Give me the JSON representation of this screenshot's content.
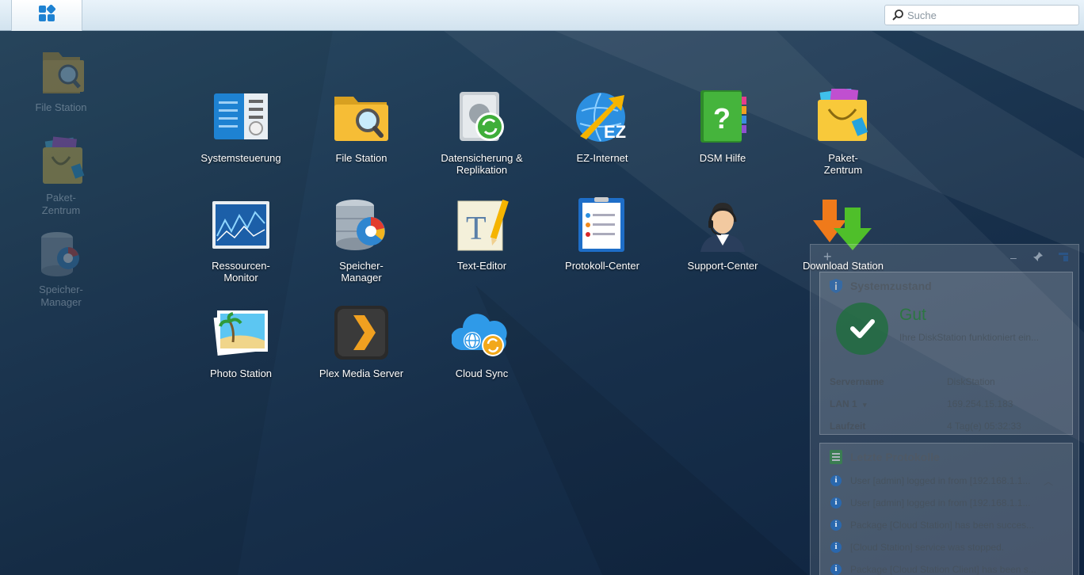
{
  "taskbar": {
    "main_menu_icon": "main-menu-grid-icon",
    "search": {
      "placeholder": "Suche",
      "value": "",
      "icon": "search-icon"
    }
  },
  "desktop_shortcuts": [
    {
      "label": "File Station",
      "icon": "file-station-icon"
    },
    {
      "label": "Paket-\nZentrum",
      "icon": "package-center-icon"
    },
    {
      "label": "Speicher-\nManager",
      "icon": "storage-manager-icon"
    }
  ],
  "main_menu": {
    "apps": [
      {
        "label": "Systemsteuerung",
        "icon": "control-panel-icon"
      },
      {
        "label": "File Station",
        "icon": "file-station-icon"
      },
      {
        "label": "Datensicherung &\nReplikation",
        "icon": "backup-replication-icon"
      },
      {
        "label": "EZ-Internet",
        "icon": "ez-internet-icon"
      },
      {
        "label": "DSM Hilfe",
        "icon": "help-icon"
      },
      {
        "label": "Paket-\nZentrum",
        "icon": "package-center-icon"
      },
      {
        "label": "Ressourcen-\nMonitor",
        "icon": "resource-monitor-icon"
      },
      {
        "label": "Speicher-\nManager",
        "icon": "storage-manager-icon"
      },
      {
        "label": "Text-Editor",
        "icon": "text-editor-icon"
      },
      {
        "label": "Protokoll-Center",
        "icon": "log-center-icon"
      },
      {
        "label": "Support-Center",
        "icon": "support-center-icon"
      },
      {
        "label": "Download Station",
        "icon": "download-station-icon"
      },
      {
        "label": "Photo Station",
        "icon": "photo-station-icon"
      },
      {
        "label": "Plex Media Server",
        "icon": "plex-icon"
      },
      {
        "label": "Cloud Sync",
        "icon": "cloud-sync-icon"
      }
    ]
  },
  "widgets": {
    "toolbar": {
      "add": "+",
      "minimize": "–"
    },
    "system_health": {
      "title": "Systemzustand",
      "status": "Gut",
      "status_text": "Ihre DiskStation funktioniert ein...",
      "rows": [
        {
          "key": "Servername",
          "value": "DiskStation"
        },
        {
          "key": "LAN 1",
          "value": "169.254.15.183"
        },
        {
          "key": "Laufzeit",
          "value": "4 Tag(e) 05:32:33"
        }
      ]
    },
    "recent_logs": {
      "title": "Letzte Protokolle",
      "items": [
        "User [admin] logged in from [192.168.1.1...",
        "User [admin] logged in from [192.168.1.1...",
        "Package [Cloud Station] has been succes...",
        "[Cloud Station] service was stopped.",
        "Package [Cloud Station Client] has been s..."
      ]
    }
  },
  "colors": {
    "taskbar": "#d2e3ef",
    "accent": "#1e82d2",
    "health_green": "#1e6e3c"
  }
}
